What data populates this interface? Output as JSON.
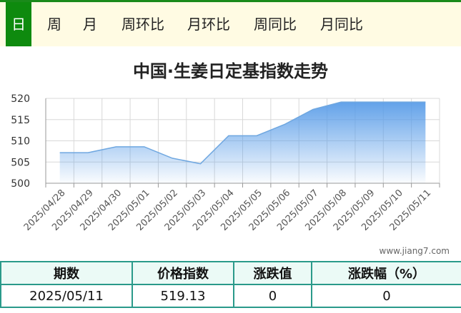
{
  "tabs": [
    {
      "label": "日",
      "active": true
    },
    {
      "label": "周",
      "active": false
    },
    {
      "label": "月",
      "active": false
    },
    {
      "label": "周环比",
      "active": false
    },
    {
      "label": "月环比",
      "active": false
    },
    {
      "label": "周同比",
      "active": false
    },
    {
      "label": "月同比",
      "active": false
    }
  ],
  "watermark": "www.jiang7.com",
  "table": {
    "headers": [
      "期数",
      "价格指数",
      "涨跌值",
      "涨跌幅（%）"
    ],
    "row": [
      "2025/05/11",
      "519.13",
      "0",
      "0"
    ]
  },
  "colors": {
    "tab_active": "#0e8a0e",
    "area_top": "#5a9de8",
    "line": "#6fa7e0",
    "table_border": "#2a9a8a"
  },
  "chart_data": {
    "type": "area",
    "title": "中国·生姜日定基指数走势",
    "xlabel": "",
    "ylabel": "",
    "x": [
      "2025/04/28",
      "2025/04/29",
      "2025/04/30",
      "2025/05/01",
      "2025/05/02",
      "2025/05/03",
      "2025/05/04",
      "2025/05/05",
      "2025/05/06",
      "2025/05/07",
      "2025/05/08",
      "2025/05/09",
      "2025/05/10",
      "2025/05/11"
    ],
    "values": [
      507.2,
      507.2,
      508.6,
      508.6,
      505.9,
      504.6,
      511.2,
      511.2,
      513.9,
      517.4,
      519.13,
      519.13,
      519.13,
      519.13
    ],
    "ylim": [
      500,
      520
    ],
    "yticks": [
      "500",
      "505",
      "510",
      "515",
      "520"
    ],
    "grid": true
  }
}
